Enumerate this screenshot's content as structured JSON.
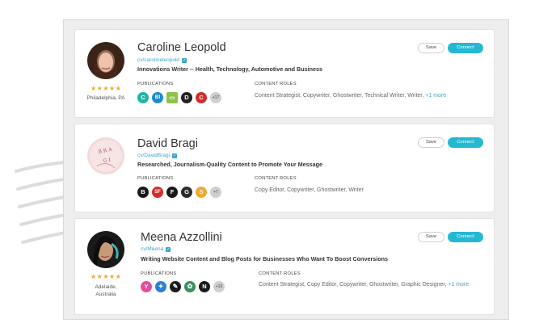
{
  "cards": [
    {
      "name": "Caroline Leopold",
      "handle": "cv/carolineleopold",
      "tagline": "Innovations Writer -- Health, Technology, Automotive and Business",
      "rating": "★★★★★",
      "location": "Philadelphia, PA",
      "publications_label": "PUBLICATIONS",
      "content_roles_label": "CONTENT ROLES",
      "roles": "Content Strategist, Copywriter, Ghostwriter, Technical Writer, Writer,",
      "roles_more": "+1 more",
      "pubs_more": "+17",
      "save_label": "Save",
      "connect_label": "Connect"
    },
    {
      "name": "David Bragi",
      "handle": "cv/DavidBragi",
      "tagline": "Researched, Journalism-Quality Content to Promote Your Message",
      "publications_label": "PUBLICATIONS",
      "content_roles_label": "CONTENT ROLES",
      "roles": "Copy Editor, Copywriter, Ghostwriter, Writer",
      "pubs_more": "+7",
      "save_label": "Save",
      "connect_label": "Connect"
    },
    {
      "name": "Meena Azzollini",
      "handle": "cv/Meena",
      "tagline": "Writing Website Content and Blog Posts for Businesses Who Want To Boost Conversions",
      "rating": "★★★★★",
      "location": "Adelaide, Australia",
      "publications_label": "PUBLICATIONS",
      "content_roles_label": "CONTENT ROLES",
      "roles": "Content Strategist, Copy Editor, Copywriter, Ghostwriter, Graphic Designer,",
      "roles_more": "+1 more",
      "pubs_more": "+10",
      "save_label": "Save",
      "connect_label": "Connect"
    }
  ],
  "pub_icons": {
    "card0": [
      {
        "letter": "C",
        "color": "#1fb5a3",
        "icon": "publication-c-icon"
      },
      {
        "letter": "BI",
        "color": "#1a8ccf",
        "icon": "business-insider-icon"
      },
      {
        "letter": "▭",
        "color": "#8bc34a",
        "icon": "publication-green-icon"
      },
      {
        "letter": "D",
        "color": "#222222",
        "icon": "publication-d-icon"
      },
      {
        "letter": "C",
        "color": "#d62b2b",
        "icon": "publication-red-c-icon"
      }
    ],
    "card1": [
      {
        "letter": "B",
        "color": "#1a1a1a",
        "icon": "publication-b-icon"
      },
      {
        "letter": "SF",
        "color": "#d62b2b",
        "icon": "publication-sf-icon"
      },
      {
        "letter": "F",
        "color": "#1a1a1a",
        "icon": "publication-f-icon"
      },
      {
        "letter": "G",
        "color": "#2b2b2b",
        "icon": "publication-g-icon"
      },
      {
        "letter": "S",
        "color": "#f0a830",
        "icon": "publication-s-icon"
      }
    ],
    "card2": [
      {
        "letter": "Y",
        "color": "#e44d9a",
        "icon": "publication-y-icon"
      },
      {
        "letter": "✦",
        "color": "#2b7fd6",
        "icon": "publication-bird-icon"
      },
      {
        "letter": "✎",
        "color": "#1a1a1a",
        "icon": "publication-pen-icon"
      },
      {
        "letter": "✿",
        "color": "#3a8f5f",
        "icon": "publication-leaf-icon"
      },
      {
        "letter": "N",
        "color": "#1a1a1a",
        "icon": "publication-n-icon"
      }
    ]
  },
  "colors": {
    "accent": "#25b8d3",
    "link": "#3ba4d1",
    "star": "#f5a623"
  }
}
